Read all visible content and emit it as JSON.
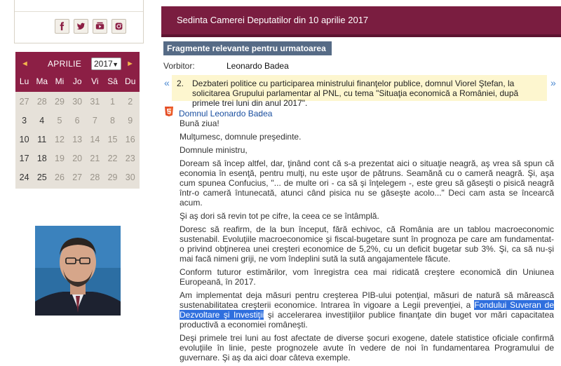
{
  "calendar": {
    "month": "APRILIE",
    "year": "2017",
    "prev_arrow": "◄",
    "next_arrow": "►",
    "weekdays": [
      "Lu",
      "Ma",
      "Mi",
      "Jo",
      "Vi",
      "Sâ",
      "Du"
    ],
    "weeks": [
      [
        "27",
        "28",
        "29",
        "30",
        "31",
        "1",
        "2"
      ],
      [
        "3",
        "4",
        "5",
        "6",
        "7",
        "8",
        "9"
      ],
      [
        "10",
        "11",
        "12",
        "13",
        "14",
        "15",
        "16"
      ],
      [
        "17",
        "18",
        "19",
        "20",
        "21",
        "22",
        "23"
      ],
      [
        "24",
        "25",
        "26",
        "27",
        "28",
        "29",
        "30"
      ]
    ]
  },
  "social": [
    "facebook-icon",
    "twitter-icon",
    "youtube-icon",
    "instagram-icon"
  ],
  "banner": {
    "title": "Sedinta Camerei Deputatilor din 10 aprilie 2017"
  },
  "fragments": {
    "label": "Fragmente relevante pentru urmatoarea interogare:"
  },
  "vorbitor": {
    "label": "Vorbitor:",
    "name": "Leonardo Badea"
  },
  "agenda": {
    "number": "2.",
    "text": "Dezbateri politice cu participarea ministrului finanţelor publice, domnul Viorel Ştefan, la solicitarea Grupului parlamentar al PNL, cu tema \"Situaţia economică a României, după primele trei luni din anul 2017\".",
    "prev": "«",
    "next": "»"
  },
  "speech": {
    "speaker": "Domnul Leonardo Badea",
    "colon": ":",
    "paragraphs": [
      "Bună ziua!",
      "Mulţumesc, domnule preşedinte.",
      "Domnule ministru,",
      "Doream să încep altfel, dar, ţinând cont că s-a prezentat aici o situaţie neagră, aş vrea să spun că economia în esenţă, pentru mulţi, nu este uşor de pătruns. Seamănă cu o cameră neagră. Şi, aşa cum spunea Confucius, \"... de multe ori - ca să şi înţelegem -, este greu să găseşti o pisică neagră într-o cameră întunecată, atunci când pisica nu se găseşte acolo...\" Deci cam asta se încearcă acum.",
      "Şi aş dori să revin tot pe cifre, la ceea ce se întâmplă.",
      "Doresc să reafirm, de la bun început, fără echivoc, că România are un tablou macroeconomic sustenabil. Evoluţiile macroeconomice şi fiscal-bugetare sunt în prognoza pe care am fundamentat-o privind obţinerea unei creşteri economice de 5,2%, cu un deficit bugetar sub 3%. Şi, ca să nu-şi mai facă nimeni griji, ne vom îndeplini sută la sută angajamentele făcute.",
      "Conform tuturor estimărilor, vom înregistra cea mai ridicată creştere economică din Uniunea Europeană, în 2017."
    ],
    "p8_before": "Am implementat deja măsuri pentru creşterea PIB-ului potenţial, măsuri de natură să mărească sustenabilitatea creşterii economice. Intrarea în vigoare a Legii prevenţiei, a ",
    "p8_highlight": "Fondului Suveran de Dezvoltare şi Investiţii",
    "p8_after": " şi accelerarea investiţiilor publice finanţate din buget vor mări capacitatea productivă a economiei româneşti.",
    "p9": "Deşi primele trei luni au fost afectate de diverse şocuri exogene, datele statistice oficiale confirmă evoluţiile în linie, peste prognozele avute în vedere de noi în fundamentarea Programului de guvernare. Şi aş da aici doar câteva exemple."
  },
  "colors": {
    "maroon": "#7a1d40",
    "calendar_head": "#8c1f45",
    "fragment_bar": "#566b86",
    "agenda_bg": "#fdf6cf",
    "link": "#1a4fa0",
    "highlight": "#2f6fde"
  }
}
